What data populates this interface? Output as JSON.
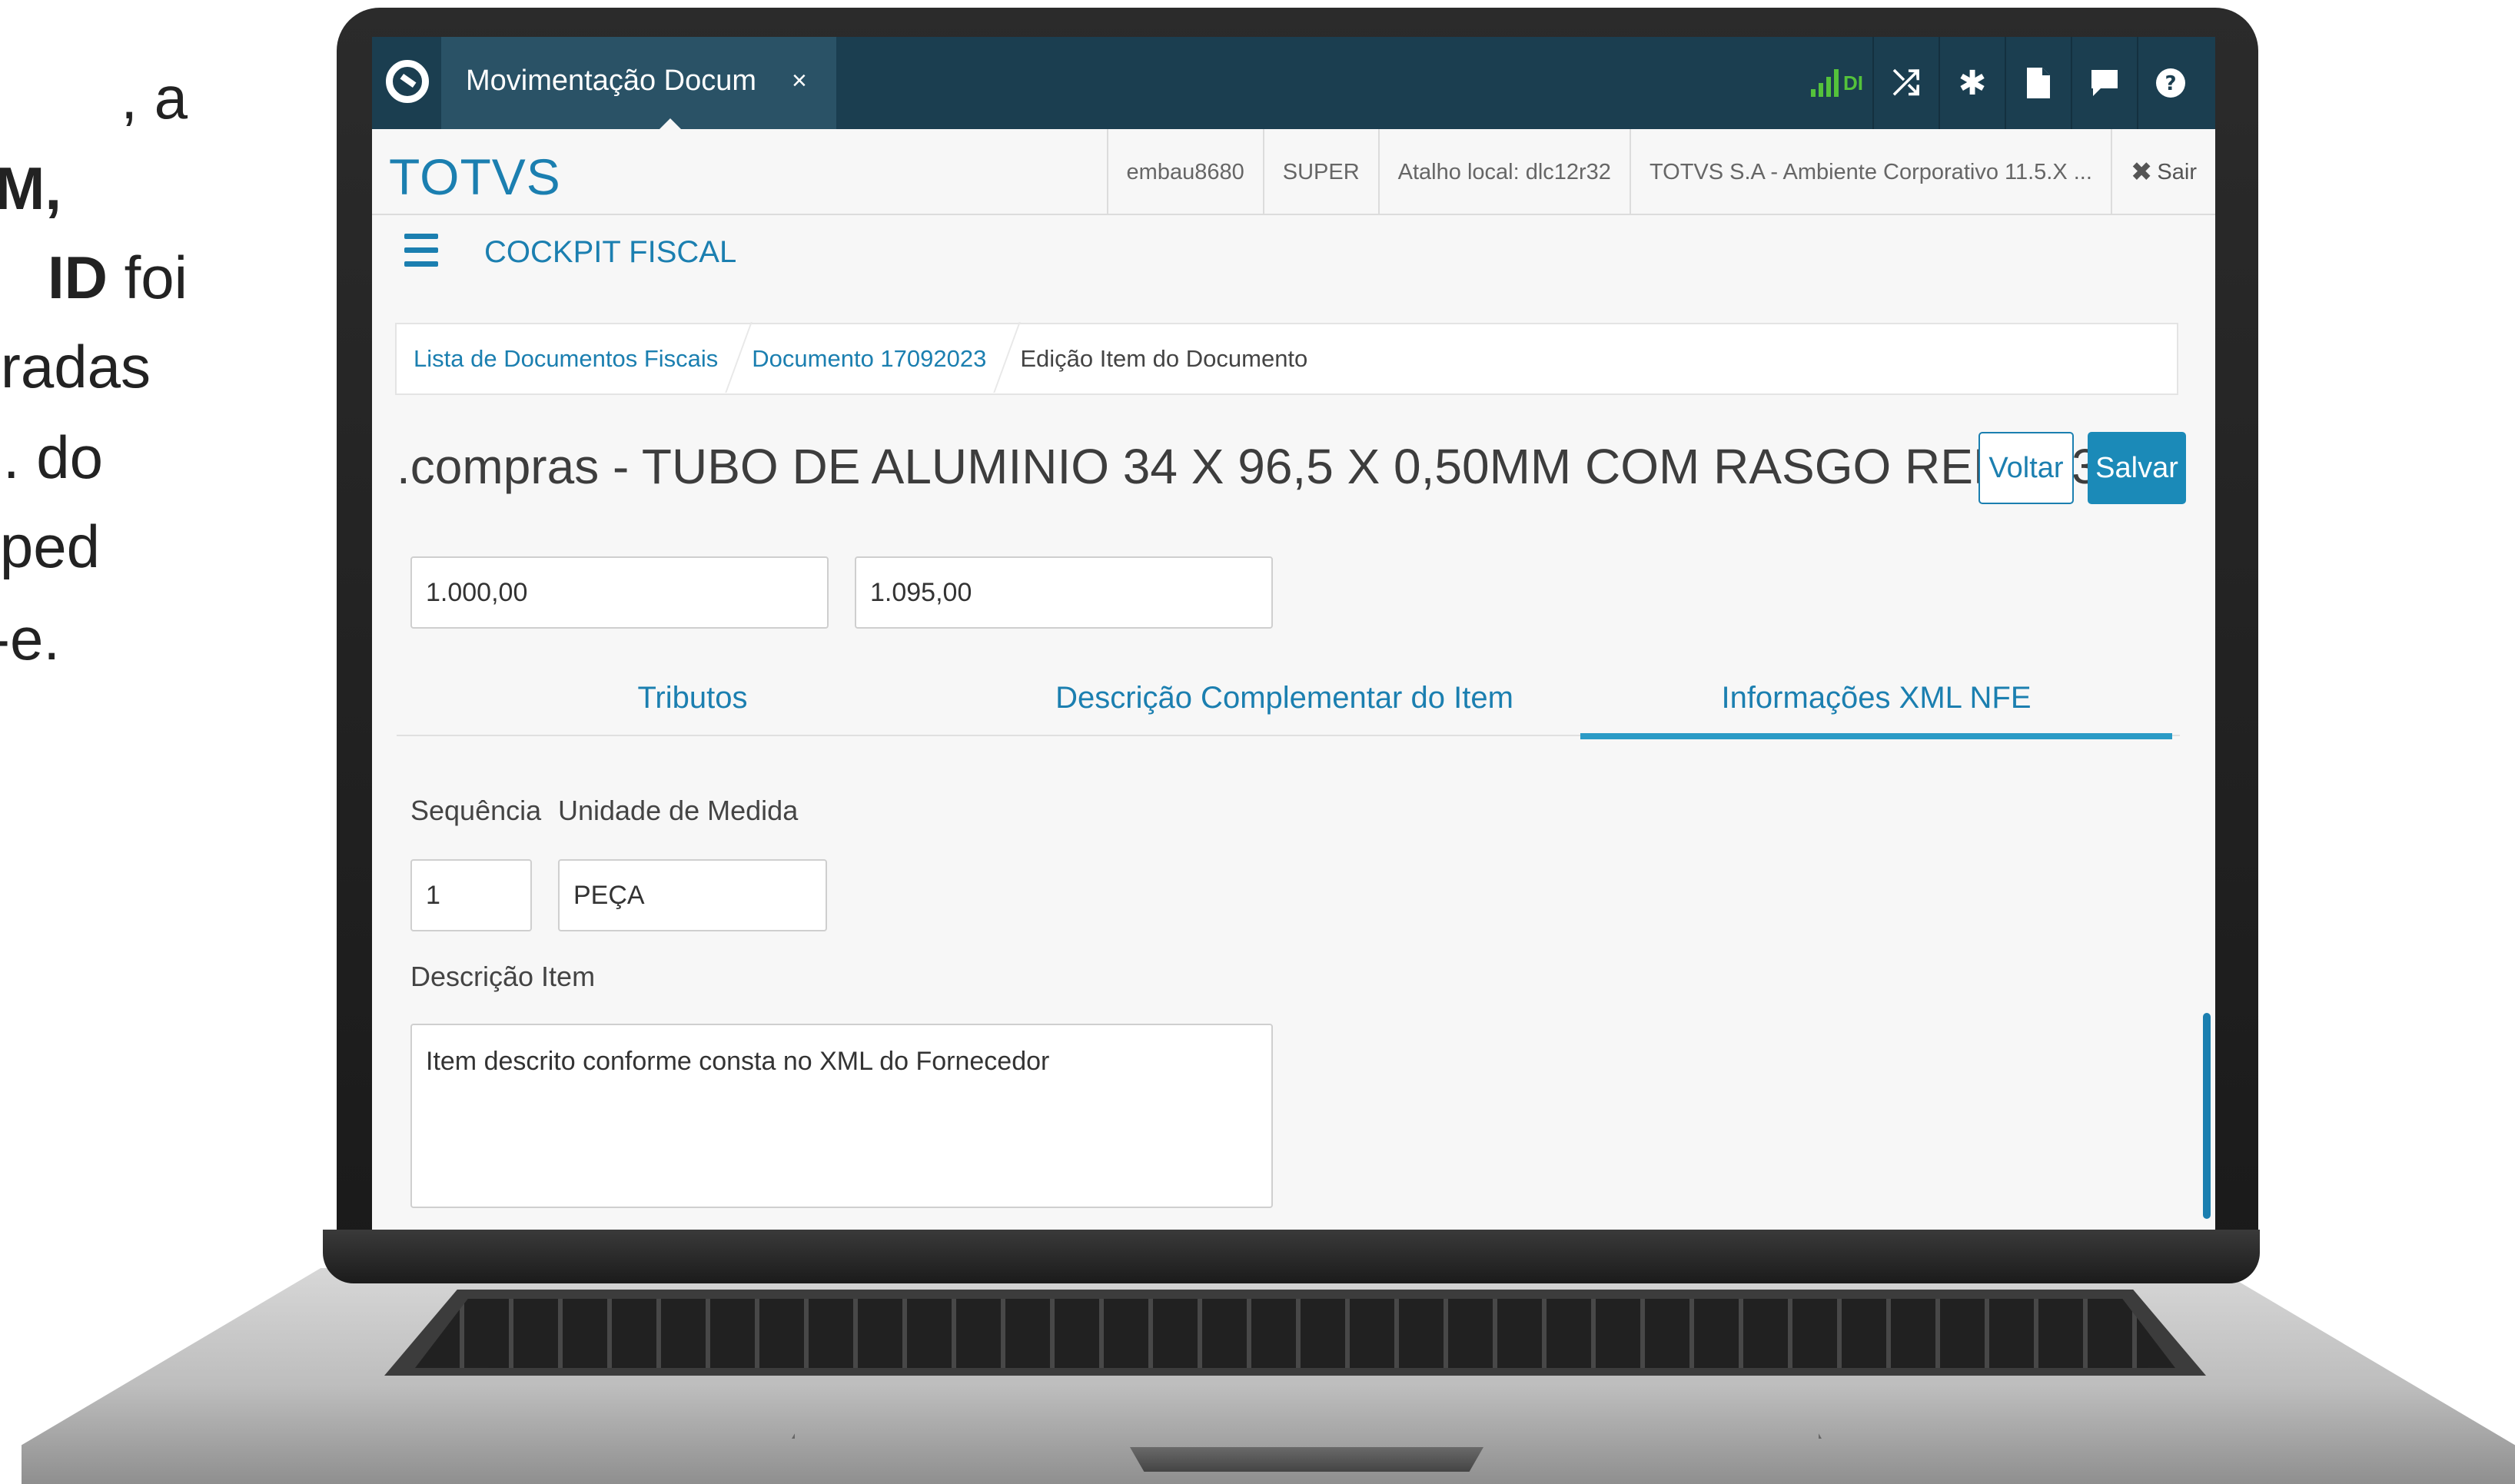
{
  "slide": {
    "lines": [
      ", a",
      "M,",
      "ID",
      " foi",
      "radas",
      ". do",
      "ped",
      "-e."
    ]
  },
  "app": {
    "tab_title": "Movimentação Docum",
    "tab_close": "×",
    "signal_label": "DI",
    "brand": "TOTVS",
    "header_items": {
      "user": "embau8680",
      "role": "SUPER",
      "shortcut": "Atalho local: dlc12r32",
      "environment": "TOTVS S.A - Ambiente Corporativo 11.5.X ...",
      "exit": "Sair",
      "exit_icon": "✖"
    },
    "nav_title": "COCKPIT FISCAL",
    "breadcrumb": [
      "Lista de Documentos Fiscais",
      "Documento 17092023",
      "Edição Item do Documento"
    ],
    "page_title": ".compras - TUBO DE ALUMINIO 34 X 96,5 X 0,50MM COM RASGO REF 7337",
    "buttons": {
      "back": "Voltar",
      "save": "Salvar"
    },
    "fields": {
      "value1": "1.000,00",
      "value2": "1.095,00"
    },
    "tabs": [
      "Tributos",
      "Descrição Complementar do Item",
      "Informações XML NFE"
    ],
    "active_tab": 2,
    "form": {
      "seq_label": "Sequência",
      "unit_label": "Unidade de Medida",
      "seq_value": "1",
      "unit_value": "PEÇA",
      "desc_label": "Descrição Item",
      "desc_value": "Item descrito conforme consta no XML do Fornecedor"
    },
    "colors": {
      "topbar": "#1b3e50",
      "accent": "#1b7fb0",
      "signal": "#54c23b"
    },
    "icons": [
      "signal-icon",
      "shuffle-icon",
      "gear-icon",
      "document-icon",
      "chat-icon",
      "help-icon"
    ]
  }
}
